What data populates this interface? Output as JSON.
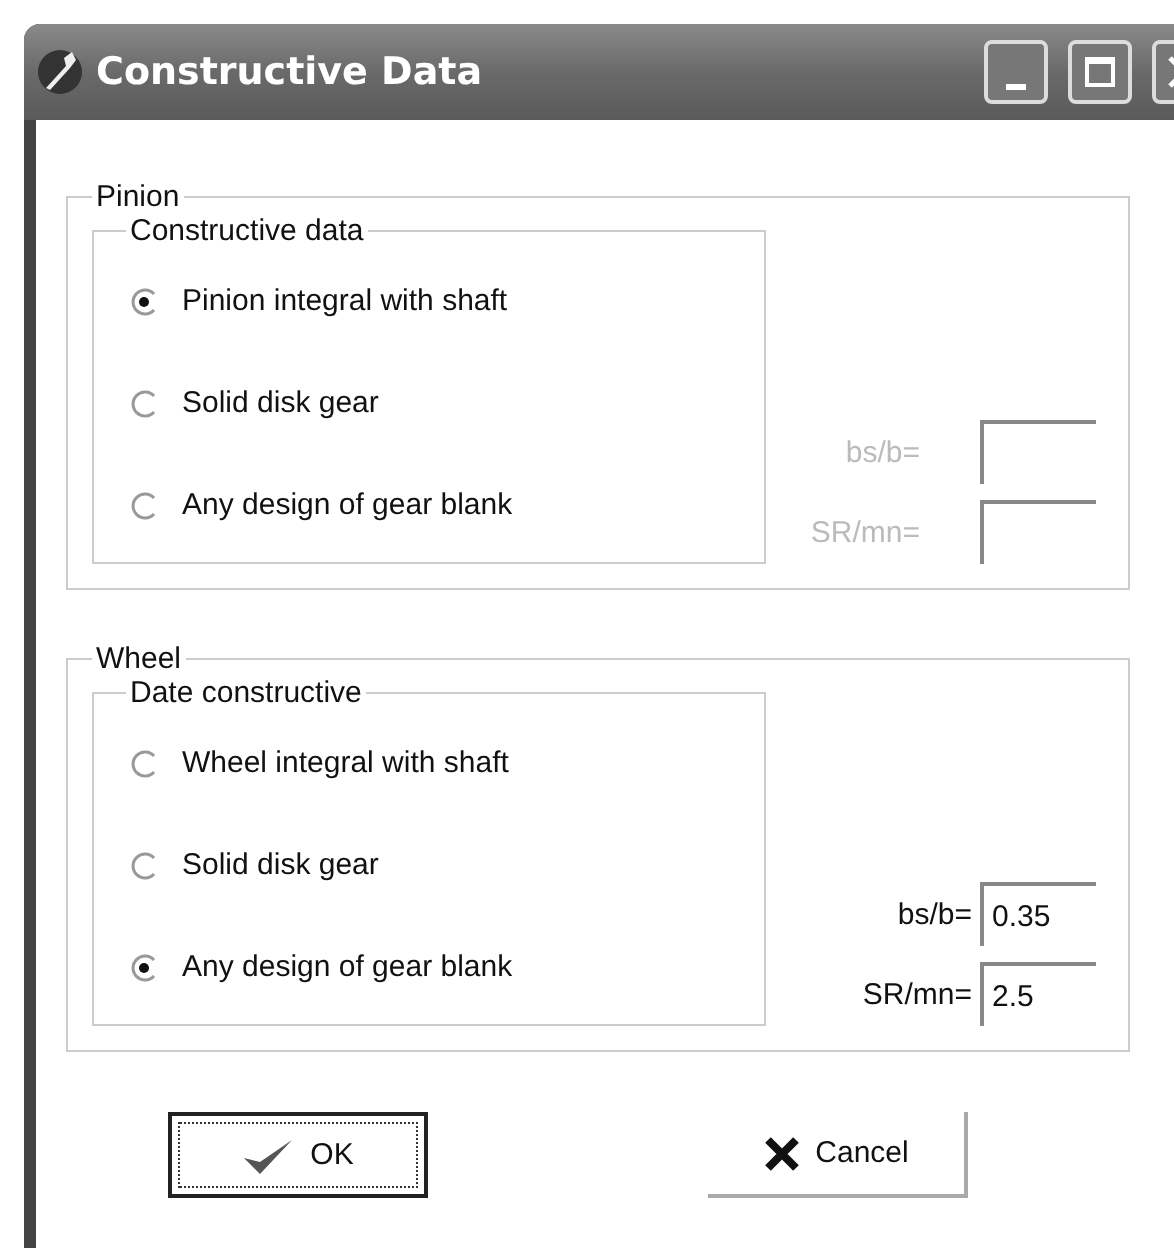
{
  "window": {
    "title": "Constructive Data"
  },
  "groups": [
    {
      "title": "Pinion",
      "inner_title": "Constructive data",
      "options": [
        {
          "label": "Pinion integral with shaft",
          "selected": true
        },
        {
          "label": "Solid disk gear",
          "selected": false
        },
        {
          "label": "Any design of gear blank",
          "selected": false
        }
      ],
      "fields": [
        {
          "label": "bs/b=",
          "disabled": true
        },
        {
          "label": "SR/mn=",
          "disabled": true
        }
      ]
    },
    {
      "title": "Wheel",
      "inner_title": "Date constructive",
      "options": [
        {
          "label": "Wheel integral with shaft",
          "selected": false
        },
        {
          "label": "Solid disk gear",
          "selected": false
        },
        {
          "label": "Any design of gear blank",
          "selected": true
        }
      ],
      "fields": [
        {
          "label": "bs/b=",
          "value": "0.35",
          "disabled": false
        },
        {
          "label": "SR/mn=",
          "value": "2.5",
          "disabled": false
        }
      ]
    }
  ],
  "buttons": [
    {
      "label": "OK",
      "kind": "ok",
      "default": true
    },
    {
      "label": "Cancel",
      "kind": "cancel",
      "default": false
    }
  ]
}
